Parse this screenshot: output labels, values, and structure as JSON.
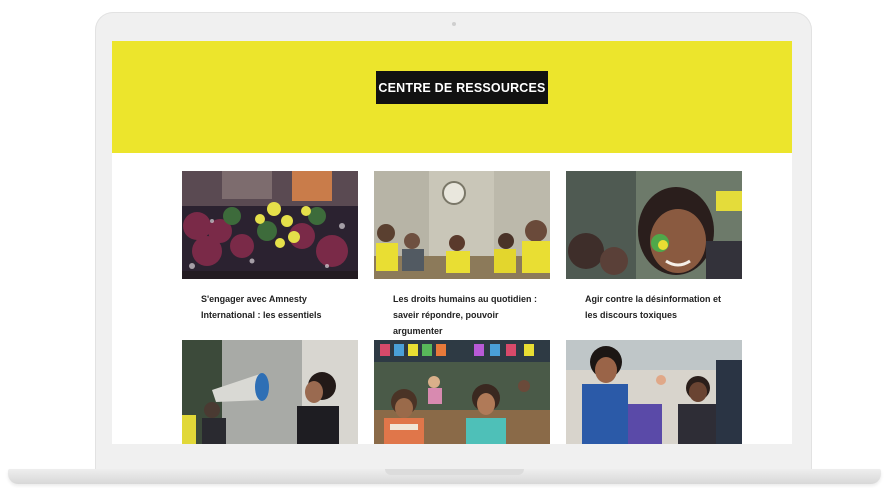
{
  "page": {
    "hero_title": "CENTRE DE RESSOURCES",
    "hero_color": "#ece52c"
  },
  "cards": [
    {
      "title": "S'engager avec Amnesty International : les essentiels",
      "image": "crowd-with-yellow-balloons-photo"
    },
    {
      "title": "Les droits humains au quotidien : saveir répondre, pouvoir argumenter",
      "image": "classroom-discussion-photo"
    },
    {
      "title": "Agir contre la désinformation et les discours toxiques",
      "image": "smiling-woman-face-paint-photo"
    },
    {
      "title": "",
      "image": "woman-with-megaphone-photo"
    },
    {
      "title": "",
      "image": "children-in-classroom-photo"
    },
    {
      "title": "",
      "image": "students-at-desk-photo"
    }
  ]
}
